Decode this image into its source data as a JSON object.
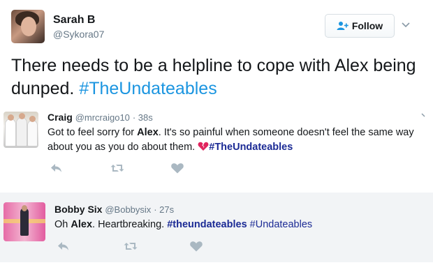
{
  "main_tweet": {
    "display_name": "Sarah B",
    "handle": "@Sykora07",
    "follow_label": "Follow",
    "text": "There needs to be a helpline to cope with Alex being dunped.",
    "hashtag": "#TheUndateables"
  },
  "reply_1": {
    "display_name": "Craig",
    "handle": "@mrcraigo10",
    "time": "· 38s",
    "text_prefix": "Got to feel sorry for",
    "mention": "Alex",
    "text_suffix": ". It's so painful when someone doesn't feel the same way about you as you do about them.",
    "hashtag": "#TheUndateables"
  },
  "reply_2": {
    "display_name": "Bobby Six",
    "handle": "@Bobbysix",
    "time": "· 27s",
    "text_prefix": "Oh",
    "mention": "Alex",
    "text_middle": ". Heartbreaking.",
    "hashtag_1": "#theundateables",
    "hashtag_2": "#Undateables"
  },
  "icons": {
    "follow": "add-user-icon",
    "caret": "chevron-down-icon",
    "reply": "reply-icon",
    "retweet": "retweet-icon",
    "like": "heart-icon",
    "emoji": "broken-heart-icon"
  },
  "colors": {
    "hashtag_main": "#1b95e0",
    "hashtag_reply": "#1c2b95",
    "muted": "#657786",
    "action_icon": "#aab8c2",
    "reply_bg": "#f2f4f6",
    "broken_heart": "#e0245e"
  }
}
